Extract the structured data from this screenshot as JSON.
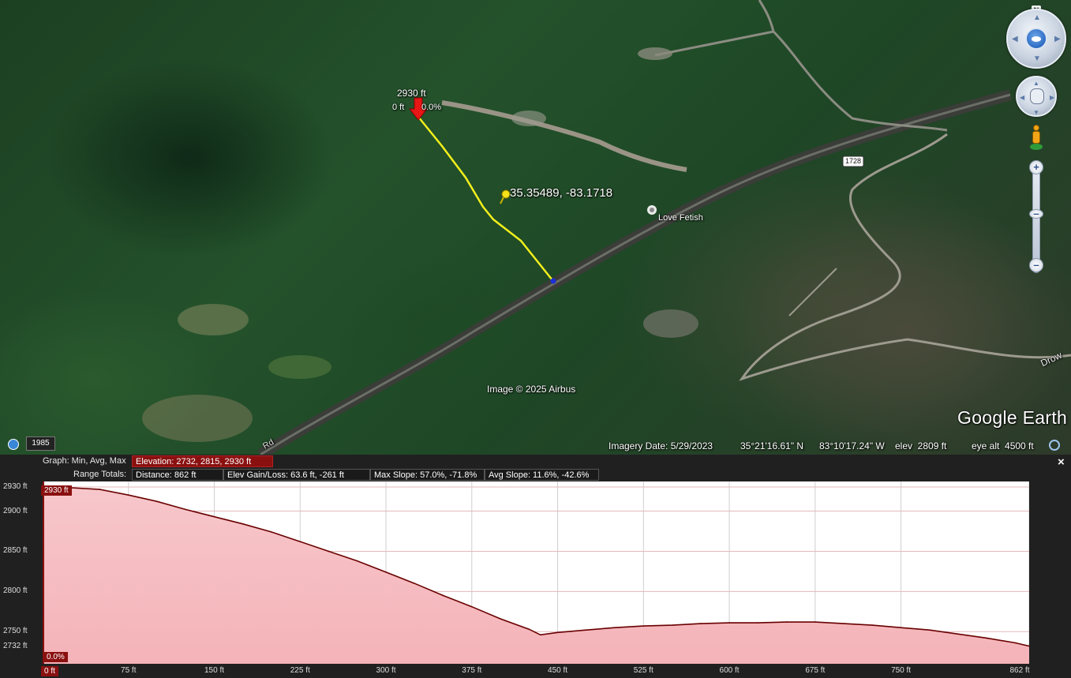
{
  "map": {
    "path_start_elev": "2930 ft",
    "path_start_dist": "0 ft",
    "path_start_slope": "0.0%",
    "placemark_label": "35.35489, -83.1718",
    "poi_label": "Love Fetish",
    "road_shield": "1728",
    "road_partial_label": "Drow",
    "road_partial_label_left": "Rd",
    "attribution": "Image © 2025 Airbus",
    "logo": "Google Earth",
    "historical_year": "1985",
    "north_label": "N",
    "status": {
      "imagery_date": "Imagery Date: 5/29/2023",
      "lat": "35°21'16.61\" N",
      "lon": "83°10'17.24\" W",
      "elev": "elev  2809 ft",
      "eye_alt": "eye alt  4500 ft"
    }
  },
  "profile": {
    "graph_label": "Graph: Min, Avg, Max",
    "elevation_box": "Elevation: 2732, 2815, 2930 ft",
    "range_totals_label": "Range Totals:",
    "distance_box": "Distance: 862 ft",
    "elev_gain_box": "Elev Gain/Loss: 63.6 ft, -261 ft",
    "max_slope_box": "Max Slope: 57.0%, -71.8%",
    "avg_slope_box": "Avg Slope: 11.6%, -42.6%",
    "close": "×",
    "cursor_elev_badge": "2930 ft",
    "cursor_slope_badge": "0.0%",
    "cursor_dist_badge": "0 ft"
  },
  "chart_data": {
    "type": "area",
    "x": [
      0,
      25,
      50,
      75,
      100,
      125,
      150,
      175,
      200,
      225,
      250,
      275,
      300,
      325,
      350,
      375,
      400,
      425,
      435,
      450,
      475,
      500,
      525,
      550,
      575,
      600,
      625,
      650,
      675,
      700,
      725,
      750,
      775,
      800,
      825,
      850,
      862
    ],
    "y": [
      2930,
      2929,
      2927,
      2920,
      2912,
      2902,
      2893,
      2884,
      2874,
      2862,
      2850,
      2838,
      2824,
      2810,
      2795,
      2781,
      2766,
      2753,
      2746,
      2749,
      2752,
      2755,
      2757,
      2758,
      2760,
      2761,
      2761,
      2762,
      2762,
      2760,
      2758,
      2755,
      2752,
      2747,
      2742,
      2736,
      2732
    ],
    "xlabel": "",
    "ylabel": "",
    "xlim": [
      0,
      862
    ],
    "ylim": [
      2710,
      2930
    ],
    "x_ticks": [
      "0 ft",
      "75 ft",
      "150 ft",
      "225 ft",
      "300 ft",
      "375 ft",
      "450 ft",
      "525 ft",
      "600 ft",
      "675 ft",
      "750 ft",
      "862 ft"
    ],
    "x_tick_values": [
      0,
      75,
      150,
      225,
      300,
      375,
      450,
      525,
      600,
      675,
      750,
      862
    ],
    "y_ticks": [
      "2930 ft",
      "2900 ft",
      "2850 ft",
      "2800 ft",
      "2750 ft",
      "2732 ft"
    ],
    "y_tick_values": [
      2930,
      2900,
      2850,
      2800,
      2750,
      2732
    ],
    "grid": true,
    "fill_color": "#f4b3b8",
    "line_color": "#6a0000"
  }
}
